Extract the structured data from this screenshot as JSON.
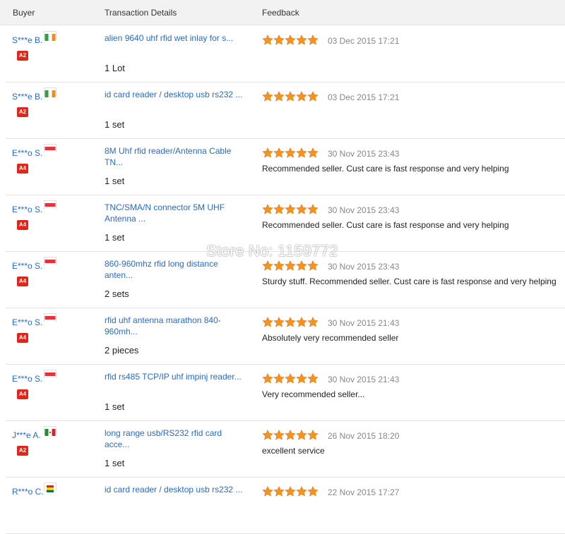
{
  "header": {
    "buyer_label": "Buyer",
    "details_label": "Transaction Details",
    "feedback_label": "Feedback"
  },
  "watermark": "Store No: 1159772",
  "rows": [
    {
      "buyer": "S***e B.",
      "flag": "ireland",
      "badge": "A2",
      "product": "alien 9640 uhf rfid wet inlay for s...",
      "qty": "1 Lot",
      "stars": 5,
      "date": "03 Dec 2015 17:21",
      "comment": ""
    },
    {
      "buyer": "S***e B.",
      "flag": "ireland",
      "badge": "A2",
      "product": "id card reader / desktop usb rs232 ...",
      "qty": "1 set",
      "stars": 5,
      "date": "03 Dec 2015 17:21",
      "comment": ""
    },
    {
      "buyer": "E***o S.",
      "flag": "singapore",
      "badge": "A4",
      "product": "8M Uhf rfid reader/Antenna Cable TN...",
      "qty": "1 set",
      "stars": 5,
      "date": "30 Nov 2015 23:43",
      "comment": "Recommended seller. Cust care is fast response and very helping"
    },
    {
      "buyer": "E***o S.",
      "flag": "singapore",
      "badge": "A4",
      "product": "TNC/SMA/N connector 5M UHF Antenna ...",
      "qty": "1 set",
      "stars": 5,
      "date": "30 Nov 2015 23:43",
      "comment": "Recommended seller. Cust care is fast response and very helping"
    },
    {
      "buyer": "E***o S.",
      "flag": "singapore",
      "badge": "A4",
      "product": "860-960mhz rfid long distance anten...",
      "qty": "2 sets",
      "stars": 5,
      "date": "30 Nov 2015 23:43",
      "comment": "Sturdy stuff. Recommended seller. Cust care is fast response and very helping"
    },
    {
      "buyer": "E***o S.",
      "flag": "singapore",
      "badge": "A4",
      "product": "rfid uhf antenna marathon 840-960mh...",
      "qty": "2 pieces",
      "stars": 5,
      "date": "30 Nov 2015 21:43",
      "comment": "Absolutely very recommended seller"
    },
    {
      "buyer": "E***o S.",
      "flag": "singapore",
      "badge": "A4",
      "product": "rfid rs485 TCP/IP uhf impinj reader...",
      "qty": "1 set",
      "stars": 5,
      "date": "30 Nov 2015 21:43",
      "comment": "Very recommended seller..."
    },
    {
      "buyer": "J***e A.",
      "flag": "mexico",
      "badge": "A2",
      "product": "long range usb/RS232 rfid card acce...",
      "qty": "1 set",
      "stars": 5,
      "date": "26 Nov 2015 18:20",
      "comment": "excellent service"
    },
    {
      "buyer": "R***o C.",
      "flag": "bolivia",
      "badge": "",
      "product": "id card reader / desktop usb rs232 ...",
      "qty": "",
      "stars": 5,
      "date": "22 Nov 2015 17:27",
      "comment": ""
    }
  ],
  "colors": {
    "link": "#2a6bbf",
    "star": "#f7931e",
    "badge": "#e0251b"
  }
}
